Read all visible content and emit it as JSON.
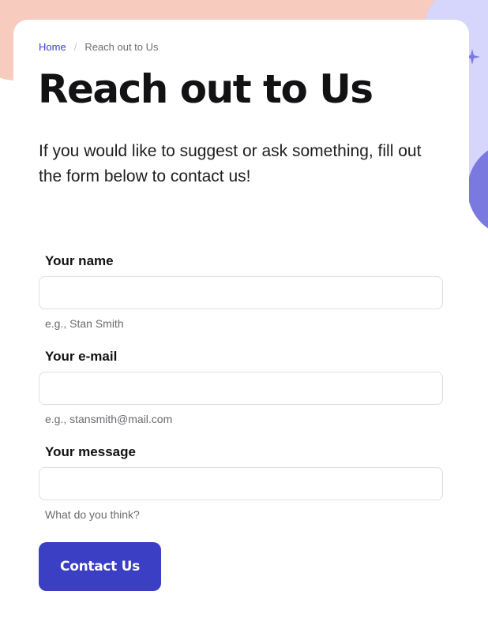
{
  "breadcrumb": {
    "home": "Home",
    "separator": "/",
    "current": "Reach out to Us"
  },
  "page": {
    "title": "Reach out to Us",
    "intro": "If you would like to suggest or ask something, fill out the form below to contact us!"
  },
  "form": {
    "name": {
      "label": "Your name",
      "value": "",
      "hint": "e.g., Stan Smith"
    },
    "email": {
      "label": "Your e-mail",
      "value": "",
      "hint": "e.g., stansmith@mail.com"
    },
    "message": {
      "label": "Your message",
      "value": "",
      "hint": "What do you think?"
    },
    "submit_label": "Contact Us"
  },
  "colors": {
    "accent": "#3a3fc3",
    "link": "#3b3fc4",
    "background_peach": "#f7cbbd",
    "background_lavender": "#d6d5fb",
    "background_indigo": "#7a79e0"
  },
  "icons": {
    "decoration": "sparkle-icon"
  }
}
